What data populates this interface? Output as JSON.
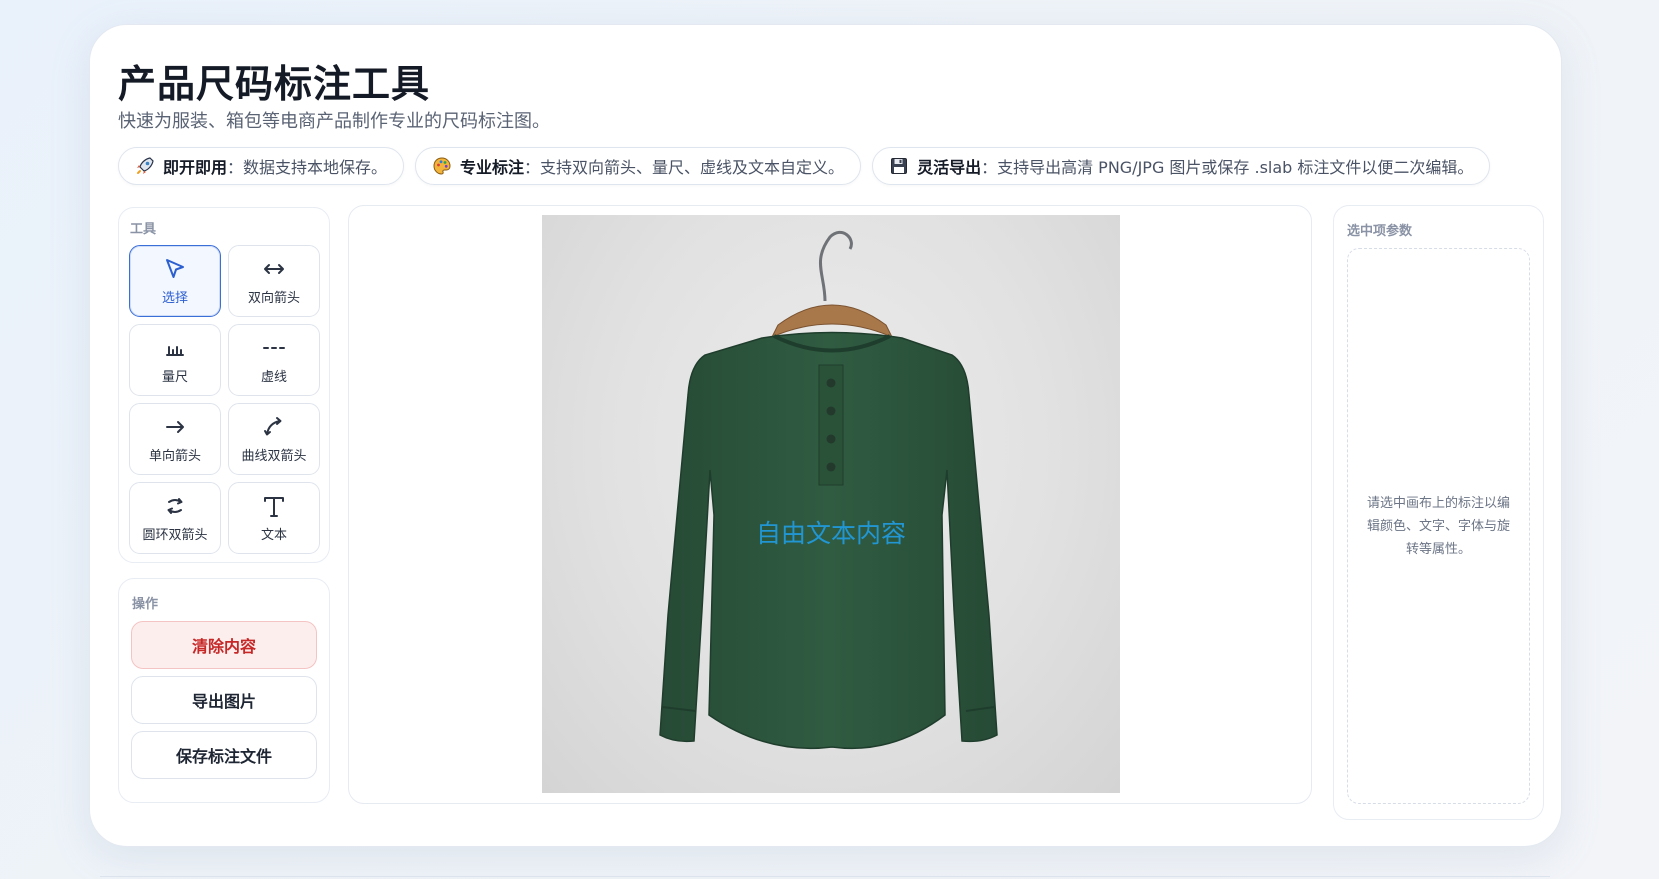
{
  "header": {
    "title": "产品尺码标注工具",
    "subtitle": "快速为服装、箱包等电商产品制作专业的尺码标注图。"
  },
  "features": [
    {
      "icon": "rocket-icon",
      "title": "即开即用",
      "desc": "：数据支持本地保存。"
    },
    {
      "icon": "palette-icon",
      "title": "专业标注",
      "desc": "：支持双向箭头、量尺、虚线及文本自定义。"
    },
    {
      "icon": "floppy-disk-icon",
      "title": "灵活导出",
      "desc": "：支持导出高清 PNG/JPG 图片或保存 .slab 标注文件以便二次编辑。"
    }
  ],
  "tools": {
    "label": "工具",
    "items": [
      {
        "key": "select",
        "icon": "cursor-arrow-icon",
        "label": "选择",
        "active": true
      },
      {
        "key": "double-arrow",
        "icon": "double-arrow-icon",
        "label": "双向箭头",
        "active": false
      },
      {
        "key": "ruler",
        "icon": "ruler-icon",
        "label": "量尺",
        "active": false
      },
      {
        "key": "dashed-line",
        "icon": "dashed-line-icon",
        "label": "虚线",
        "active": false
      },
      {
        "key": "single-arrow",
        "icon": "right-arrow-icon",
        "label": "单向箭头",
        "active": false
      },
      {
        "key": "curve-double-arrow",
        "icon": "curved-arrow-icon",
        "label": "曲线双箭头",
        "active": false
      },
      {
        "key": "ring-double-arrow",
        "icon": "ring-arrow-icon",
        "label": "圆环双箭头",
        "active": false
      },
      {
        "key": "text",
        "icon": "text-icon",
        "label": "文本",
        "active": false
      }
    ]
  },
  "operations": {
    "label": "操作",
    "clear": "清除内容",
    "export_image": "导出图片",
    "save_file": "保存标注文件"
  },
  "canvas": {
    "free_text": "自由文本内容",
    "free_text_color": "#2196d3",
    "shirt_color": "#2f5a41"
  },
  "params": {
    "label": "选中项参数",
    "empty_hint": "请选中画布上的标注以编辑颜色、文字、字体与旋转等属性。"
  },
  "colors": {
    "accent": "#3b6fd8",
    "danger": "#c62828"
  }
}
